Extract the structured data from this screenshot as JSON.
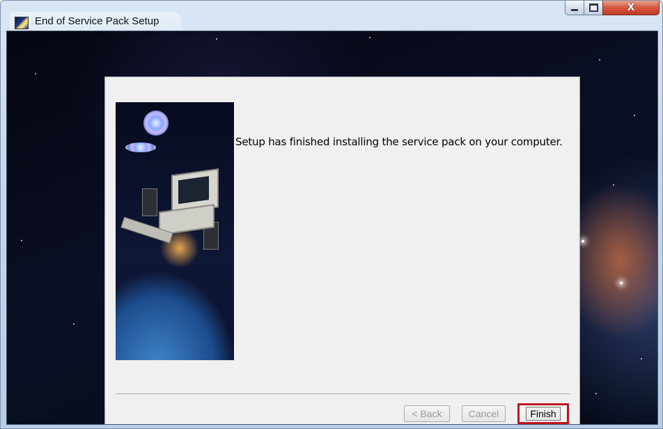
{
  "window": {
    "title": "End of Service Pack Setup",
    "icon": "setup-app-icon",
    "controls": {
      "minimize": "minimize-icon",
      "maximize": "maximize-icon",
      "close": "close-icon",
      "close_glyph": "X"
    }
  },
  "wizard": {
    "message": "Setup has finished installing the service pack on your computer.",
    "side_image": "computer-in-space-illustration",
    "buttons": {
      "back": "< Back",
      "cancel": "Cancel",
      "finish": "Finish"
    },
    "highlight_color": "#c0121b"
  }
}
